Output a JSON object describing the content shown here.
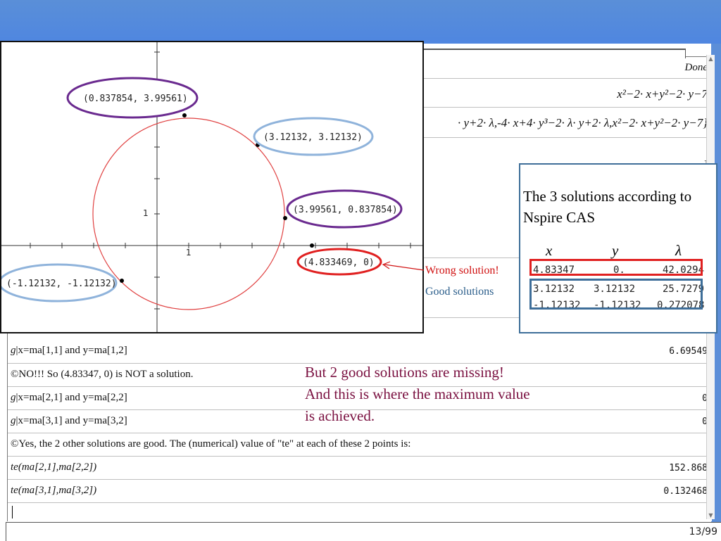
{
  "calculator": {
    "row1_output": "Done",
    "row2_output": "x²−2· x+y²−2· y−7",
    "row3_output": "· y+2· λ,-4· x+4· y³−2· λ· y+2· λ,x²−2· x+y²−2· y−7}",
    "row4_partial": "]",
    "rows": [
      {
        "input_g": "g",
        "input_rest": "|x=ma[1,1] and y=ma[1,2]",
        "output": "6.69549"
      },
      {
        "input": "©NO!!!  So (4.83347, 0) is NOT a solution.",
        "output": ""
      },
      {
        "input_g": "g",
        "input_rest": "|x=ma[2,1] and y=ma[2,2]",
        "output": "0"
      },
      {
        "input_g": "g",
        "input_rest": "|x=ma[3,1] and y=ma[3,2]",
        "output": "0"
      },
      {
        "input": "©Yes, the 2 other solutions are good.  The (numerical) value of \"te\" at each of these 2 points is:",
        "output": ""
      },
      {
        "input": "te(ma[2,1],ma[2,2])",
        "output": "152.868"
      },
      {
        "input": "te(ma[3,1],ma[3,2])",
        "output": "0.132468"
      }
    ],
    "page_indicator": "13/99"
  },
  "graph": {
    "axis_tick_x": "1",
    "axis_tick_y": "1",
    "points": [
      {
        "label": "(0.837854, 3.99561)",
        "color": "#6a2a8f"
      },
      {
        "label": "(3.12132, 3.12132)",
        "color": "#8fb3db"
      },
      {
        "label": "(3.99561, 0.837854)",
        "color": "#6a2a8f"
      },
      {
        "label": "(4.833469, 0)",
        "color": "#e02020"
      },
      {
        "label": "(-1.12132, -1.12132)",
        "color": "#8fb3db"
      }
    ]
  },
  "note": {
    "title": "The 3 solutions according to Nspire CAS",
    "col_x": "x",
    "col_y": "y",
    "col_lambda": "λ",
    "matrix": [
      [
        "4.83347",
        "0.",
        "42.0294"
      ],
      [
        "3.12132",
        "3.12132",
        "25.7279"
      ],
      [
        "-1.12132",
        "-1.12132",
        "0.272078"
      ]
    ]
  },
  "labels": {
    "wrong": "Wrong solution!",
    "good": "Good solutions",
    "missing_line1": "But 2 good solutions are missing!",
    "missing_line2": "And this is where the maximum value",
    "missing_line3": "is achieved."
  },
  "colors": {
    "header_blue": "#4f86e0",
    "circle_red": "#e04040",
    "purple": "#6a2a8f",
    "light_blue": "#8fb3db",
    "red": "#e02020",
    "dark_blue": "#3e6e99"
  }
}
